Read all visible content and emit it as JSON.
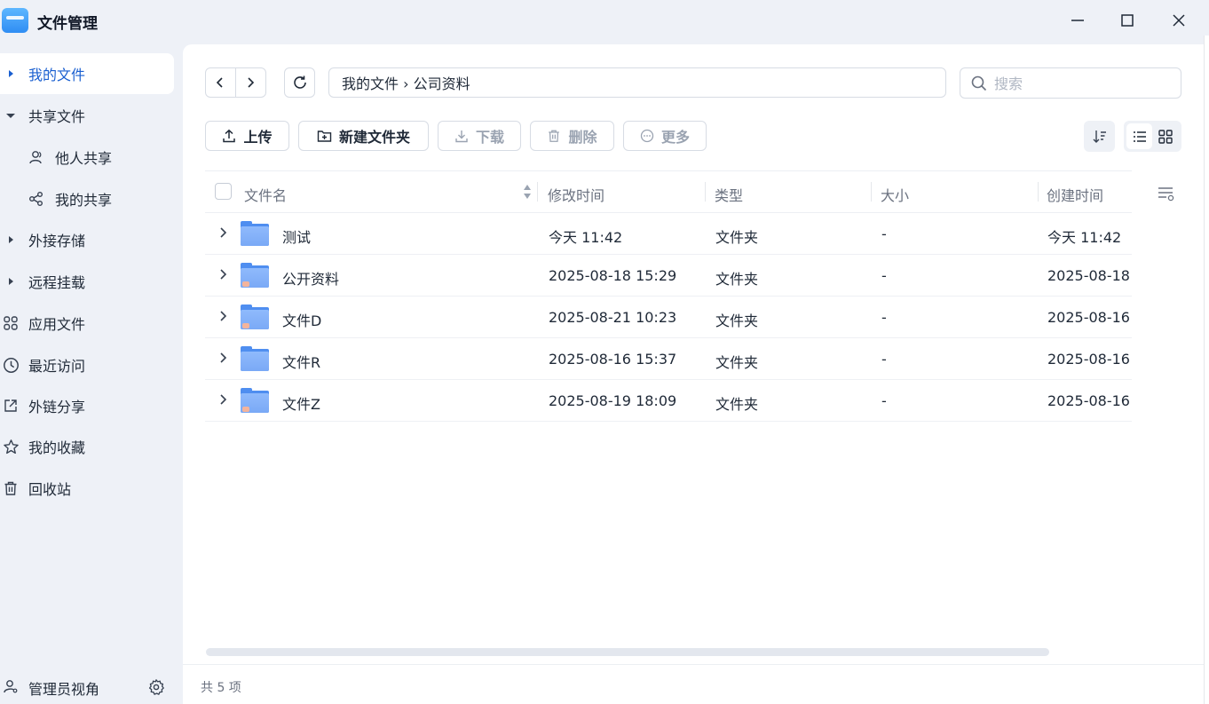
{
  "window": {
    "title": "文件管理"
  },
  "sidebar": {
    "items": [
      {
        "label": "我的文件",
        "icon": "caret-right-icon",
        "active": true
      },
      {
        "label": "共享文件",
        "icon": "caret-down-icon"
      },
      {
        "label": "他人共享",
        "icon": "users-icon",
        "sub": true
      },
      {
        "label": "我的共享",
        "icon": "share-icon",
        "sub": true
      },
      {
        "label": "外接存储",
        "icon": "caret-right-icon"
      },
      {
        "label": "远程挂载",
        "icon": "caret-right-icon"
      },
      {
        "label": "应用文件",
        "icon": "apps-grid-icon"
      },
      {
        "label": "最近访问",
        "icon": "clock-icon"
      },
      {
        "label": "外链分享",
        "icon": "external-link-icon"
      },
      {
        "label": "我的收藏",
        "icon": "star-icon"
      },
      {
        "label": "回收站",
        "icon": "trash-icon"
      }
    ],
    "admin_label": "管理员视角"
  },
  "path": {
    "text": "我的文件 › 公司资料"
  },
  "search": {
    "placeholder": "搜索"
  },
  "toolbar": {
    "upload": "上传",
    "new_folder": "新建文件夹",
    "download": "下载",
    "delete": "删除",
    "more": "更多"
  },
  "table": {
    "columns": {
      "name": "文件名",
      "modified": "修改时间",
      "type": "类型",
      "size": "大小",
      "created": "创建时间"
    },
    "rows": [
      {
        "name": "测试",
        "modified": "今天 11:42",
        "type": "文件夹",
        "size": "-",
        "created": "今天 11:42",
        "shared": false
      },
      {
        "name": "公开资料",
        "modified": "2025-08-18 15:29",
        "type": "文件夹",
        "size": "-",
        "created": "2025-08-18",
        "shared": true
      },
      {
        "name": "文件D",
        "modified": "2025-08-21 10:23",
        "type": "文件夹",
        "size": "-",
        "created": "2025-08-16",
        "shared": true
      },
      {
        "name": "文件R",
        "modified": "2025-08-16 15:37",
        "type": "文件夹",
        "size": "-",
        "created": "2025-08-16",
        "shared": false
      },
      {
        "name": "文件Z",
        "modified": "2025-08-19 18:09",
        "type": "文件夹",
        "size": "-",
        "created": "2025-08-16",
        "shared": true
      }
    ]
  },
  "footer": {
    "count": "共 5 项"
  },
  "colors": {
    "accent": "#1a5fd0",
    "folder": "#7aa9f6",
    "sidebar_bg": "#eef1f7"
  }
}
